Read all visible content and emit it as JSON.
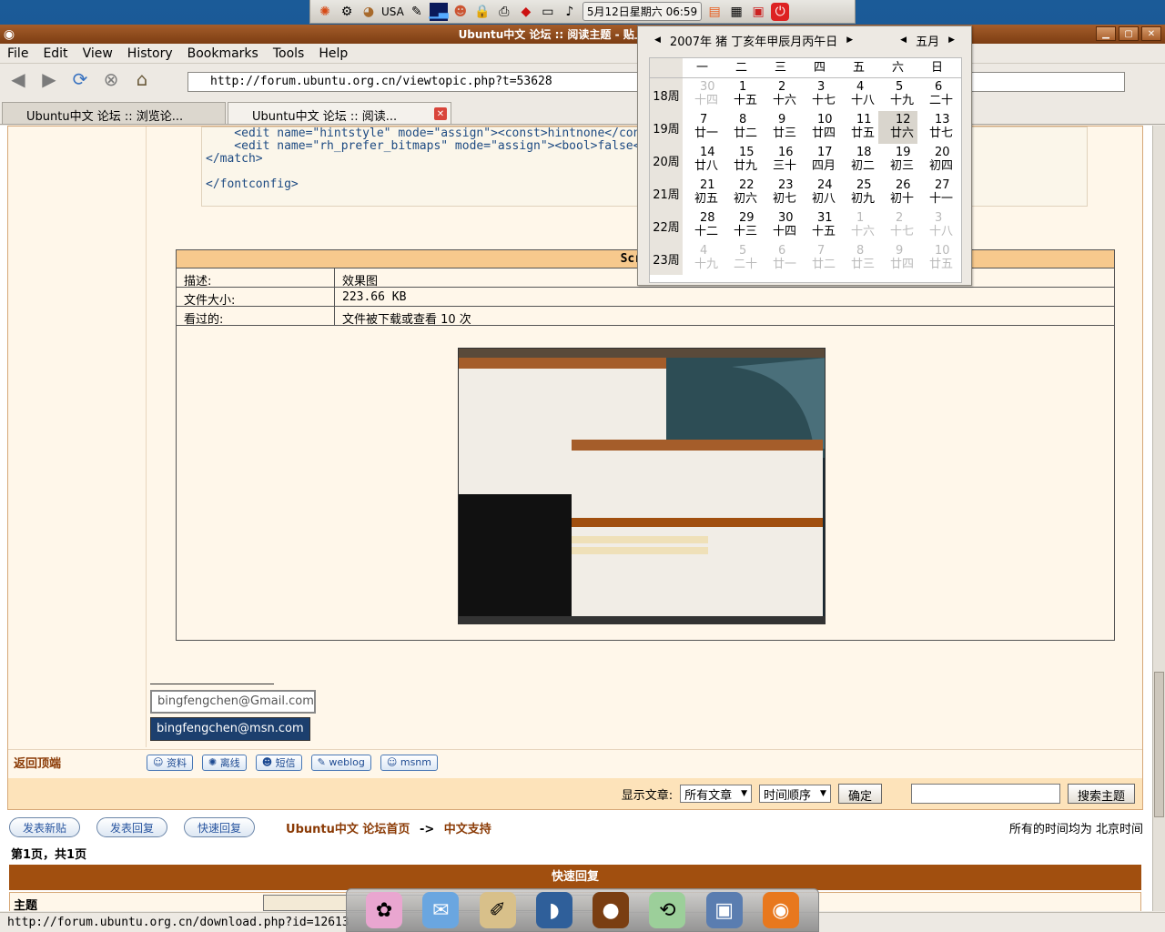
{
  "panel": {
    "layout": "USA",
    "clock": "5月12日星期六 06:59"
  },
  "window": {
    "title": "Ubuntu中文 论坛 :: 阅读主题 - 贴上自己的local"
  },
  "menu": [
    "File",
    "Edit",
    "View",
    "History",
    "Bookmarks",
    "Tools",
    "Help"
  ],
  "url": "http://forum.ubuntu.org.cn/viewtopic.php?t=53628",
  "tabs": [
    {
      "label": "Ubuntu中文 论坛 :: 浏览论..."
    },
    {
      "label": "Ubuntu中文 论坛 :: 阅读..."
    }
  ],
  "code": {
    "line1": "    <edit name=\"hintstyle\" mode=\"assign\"><const>hintnone</con",
    "line2": "    <edit name=\"rh_prefer_bitmaps\" mode=\"assign\"><bool>false<",
    "line3": "</match>",
    "line4": "",
    "line5": "</fontconfig>"
  },
  "attachment": {
    "header": "Screens",
    "desc_label": "描述:",
    "desc_value": "效果图",
    "size_label": "文件大小:",
    "size_value": "223.66 KB",
    "viewed_label": "看过的:",
    "viewed_value": "文件被下载或查看 10 次"
  },
  "signature": {
    "gmail_user": "bingfengchen",
    "gmail_domain": "Gmail.com",
    "msn_user": "bingfengchen",
    "msn_domain": "msn.com"
  },
  "post_actions": {
    "back_to_top": "返回顶端",
    "profile": "资料",
    "offline": "离线",
    "pm": "短信",
    "weblog": "weblog",
    "msnm": "msnm"
  },
  "filter": {
    "label": "显示文章:",
    "all_posts": "所有文章",
    "order": "时间顺序",
    "confirm": "确定",
    "search": "搜索主题"
  },
  "nav": {
    "new_post": "发表新贴",
    "reply": "发表回复",
    "quick_reply": "快速回复",
    "forum_index": "Ubuntu中文 论坛首页",
    "arrow": "->",
    "section": "中文支持",
    "timezone": "所有的时间均为 北京时间",
    "pages": "第1页，共1页"
  },
  "quick": {
    "title": "快速回复",
    "subject_label": "主题"
  },
  "statusbar": "http://forum.ubuntu.org.cn/download.php?id=12613",
  "calendar": {
    "year_label": "2007年 猪 丁亥年甲辰月丙午日",
    "month": "五月",
    "weekdays": [
      "一",
      "二",
      "三",
      "四",
      "五",
      "六",
      "日"
    ],
    "weeks": [
      {
        "label": "18周",
        "days": [
          [
            "30",
            "十四",
            1
          ],
          [
            "1",
            "十五",
            0
          ],
          [
            "2",
            "十六",
            0
          ],
          [
            "3",
            "十七",
            0
          ],
          [
            "4",
            "十八",
            0
          ],
          [
            "5",
            "十九",
            0
          ],
          [
            "6",
            "二十",
            0
          ]
        ]
      },
      {
        "label": "19周",
        "days": [
          [
            "7",
            "廿一",
            0
          ],
          [
            "8",
            "廿二",
            0
          ],
          [
            "9",
            "廿三",
            0
          ],
          [
            "10",
            "廿四",
            0
          ],
          [
            "11",
            "廿五",
            0
          ],
          [
            "12",
            "廿六",
            2
          ],
          [
            "13",
            "廿七",
            0
          ]
        ]
      },
      {
        "label": "20周",
        "days": [
          [
            "14",
            "廿八",
            0
          ],
          [
            "15",
            "廿九",
            0
          ],
          [
            "16",
            "三十",
            0
          ],
          [
            "17",
            "四月",
            0
          ],
          [
            "18",
            "初二",
            0
          ],
          [
            "19",
            "初三",
            0
          ],
          [
            "20",
            "初四",
            0
          ]
        ]
      },
      {
        "label": "21周",
        "days": [
          [
            "21",
            "初五",
            0
          ],
          [
            "22",
            "初六",
            0
          ],
          [
            "23",
            "初七",
            0
          ],
          [
            "24",
            "初八",
            0
          ],
          [
            "25",
            "初九",
            0
          ],
          [
            "26",
            "初十",
            0
          ],
          [
            "27",
            "十一",
            0
          ]
        ]
      },
      {
        "label": "22周",
        "days": [
          [
            "28",
            "十二",
            0
          ],
          [
            "29",
            "十三",
            0
          ],
          [
            "30",
            "十四",
            0
          ],
          [
            "31",
            "十五",
            0
          ],
          [
            "1",
            "十六",
            1
          ],
          [
            "2",
            "十七",
            1
          ],
          [
            "3",
            "十八",
            1
          ]
        ]
      },
      {
        "label": "23周",
        "days": [
          [
            "4",
            "十九",
            1
          ],
          [
            "5",
            "二十",
            1
          ],
          [
            "6",
            "廿一",
            1
          ],
          [
            "7",
            "廿二",
            1
          ],
          [
            "8",
            "廿三",
            1
          ],
          [
            "9",
            "廿四",
            1
          ],
          [
            "10",
            "廿五",
            1
          ]
        ]
      }
    ]
  }
}
